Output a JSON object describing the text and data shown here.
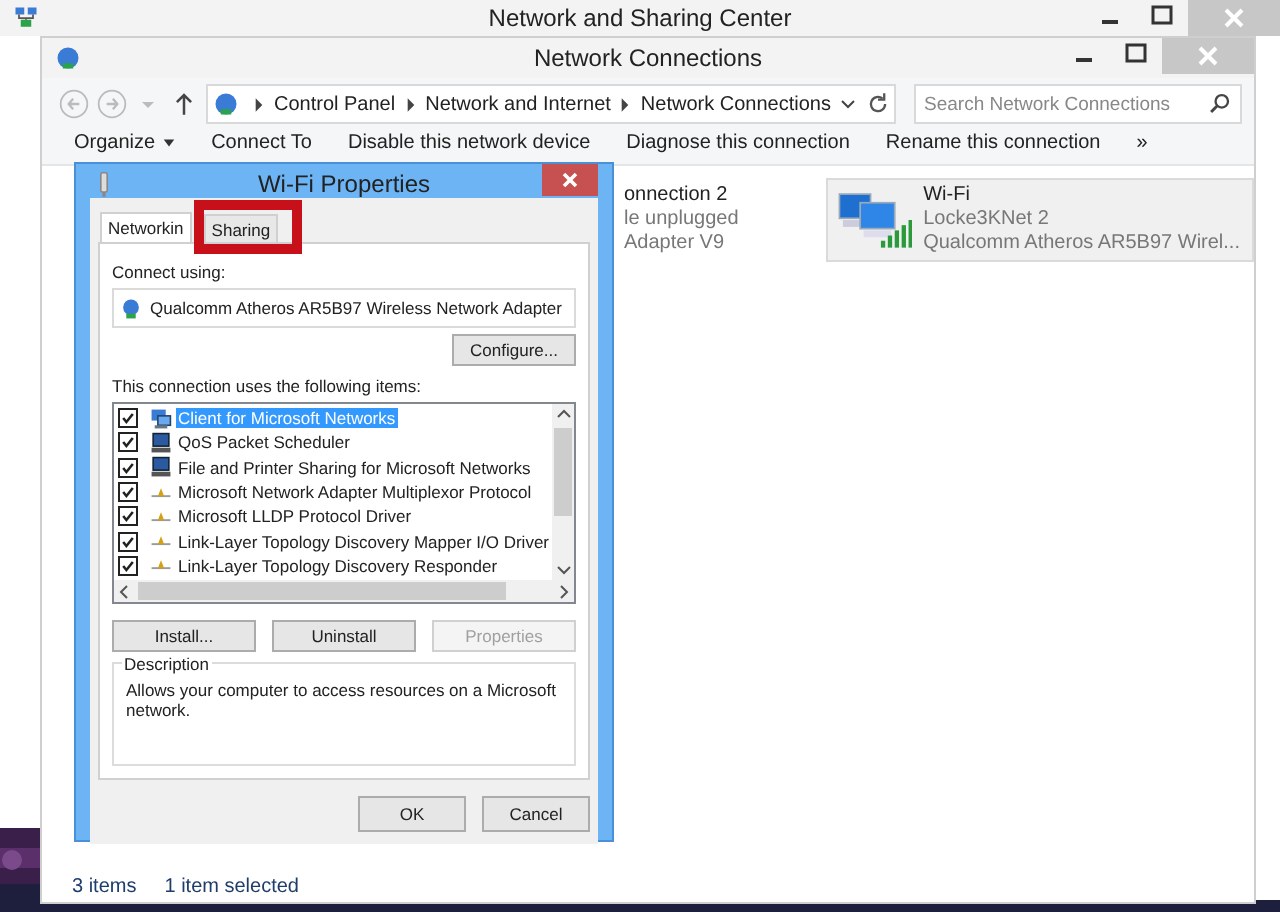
{
  "background_window": {
    "title": "Network and Sharing Center"
  },
  "window": {
    "title": "Network Connections"
  },
  "address_bar": {
    "breadcrumbs": [
      "Control Panel",
      "Network and Internet",
      "Network Connections"
    ]
  },
  "search": {
    "placeholder": "Search Network Connections"
  },
  "command_bar": {
    "items": [
      {
        "label": "Organize",
        "dropdown": true
      },
      {
        "label": "Connect To",
        "dropdown": false
      },
      {
        "label": "Disable this network device",
        "dropdown": false
      },
      {
        "label": "Diagnose this connection",
        "dropdown": false
      },
      {
        "label": "Rename this connection",
        "dropdown": false
      }
    ],
    "overflow": "»"
  },
  "connections": [
    {
      "kind": "partial",
      "name": "onnection 2",
      "status": "le unplugged",
      "device": "Adapter V9",
      "selected": false
    },
    {
      "kind": "wifi",
      "name": "Wi-Fi",
      "status": "Locke3KNet  2",
      "device": "Qualcomm Atheros AR5B97 Wirel...",
      "selected": true
    }
  ],
  "status_bar": {
    "count": "3 items",
    "selection": "1 item selected"
  },
  "dialog": {
    "title": "Wi-Fi Properties",
    "tabs": [
      {
        "label": "Networkin",
        "selected": true,
        "highlighted": false
      },
      {
        "label": "Sharing",
        "selected": false,
        "highlighted": true
      }
    ],
    "connect_using_label": "Connect using:",
    "adapter": "Qualcomm Atheros AR5B97 Wireless Network Adapter",
    "configure_button": "Configure...",
    "items_label": "This connection uses the following items:",
    "items": [
      {
        "kind": "client",
        "label": "Client for Microsoft Networks",
        "checked": true,
        "selected": true
      },
      {
        "kind": "service",
        "label": "QoS Packet Scheduler",
        "checked": true,
        "selected": false
      },
      {
        "kind": "service",
        "label": "File and Printer Sharing for Microsoft Networks",
        "checked": true,
        "selected": false
      },
      {
        "kind": "protocol",
        "label": "Microsoft Network Adapter Multiplexor Protocol",
        "checked": true,
        "selected": false
      },
      {
        "kind": "protocol",
        "label": "Microsoft LLDP Protocol Driver",
        "checked": true,
        "selected": false
      },
      {
        "kind": "protocol",
        "label": "Link-Layer Topology Discovery Mapper I/O Driver",
        "checked": true,
        "selected": false
      },
      {
        "kind": "protocol",
        "label": "Link-Layer Topology Discovery Responder",
        "checked": true,
        "selected": false
      }
    ],
    "item_buttons": [
      {
        "label": "Install...",
        "disabled": false
      },
      {
        "label": "Uninstall",
        "disabled": false
      },
      {
        "label": "Properties",
        "disabled": true
      }
    ],
    "description_label": "Description",
    "description": "Allows your computer to access resources on a Microsoft network.",
    "buttons": [
      "OK",
      "Cancel"
    ]
  }
}
